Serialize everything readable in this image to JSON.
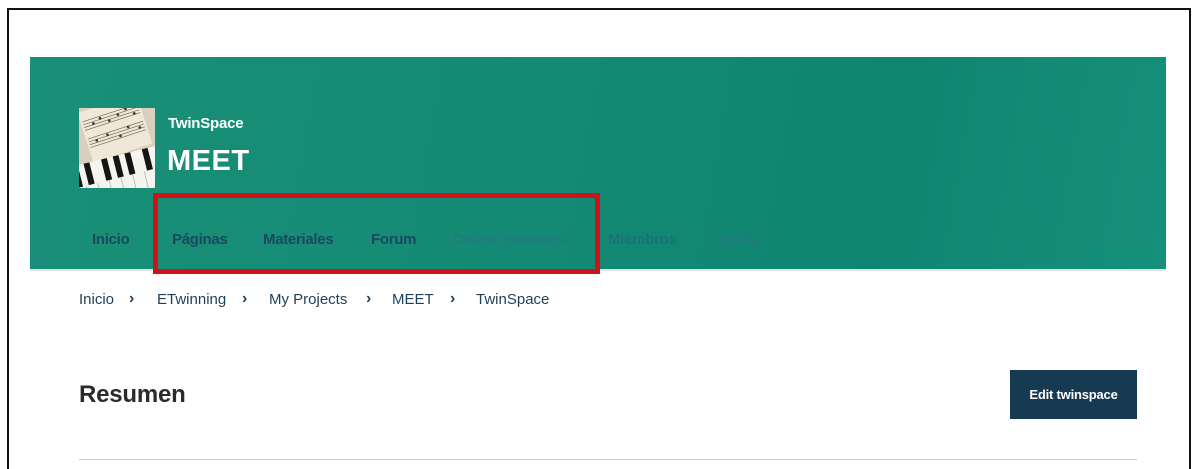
{
  "header": {
    "subtitle": "TwinSpace",
    "title": "MEET",
    "thumbnail_icon": "piano-sheet-music-image"
  },
  "nav": {
    "items": [
      {
        "label": "Inicio"
      },
      {
        "label": "Páginas"
      },
      {
        "label": "Materiales"
      },
      {
        "label": "Forum"
      },
      {
        "label": "Online meetings"
      },
      {
        "label": "Miembros"
      },
      {
        "label": "Ayuda"
      }
    ]
  },
  "breadcrumb": {
    "items": [
      "Inicio",
      "ETwinning",
      "My Projects",
      "MEET",
      "TwinSpace"
    ],
    "separator": "›"
  },
  "main": {
    "title": "Resumen",
    "edit_button": "Edit twinspace"
  },
  "colors": {
    "banner": "#148a74",
    "nav_text": "#1c4760",
    "highlight": "#d0121b",
    "button": "#163a52"
  }
}
